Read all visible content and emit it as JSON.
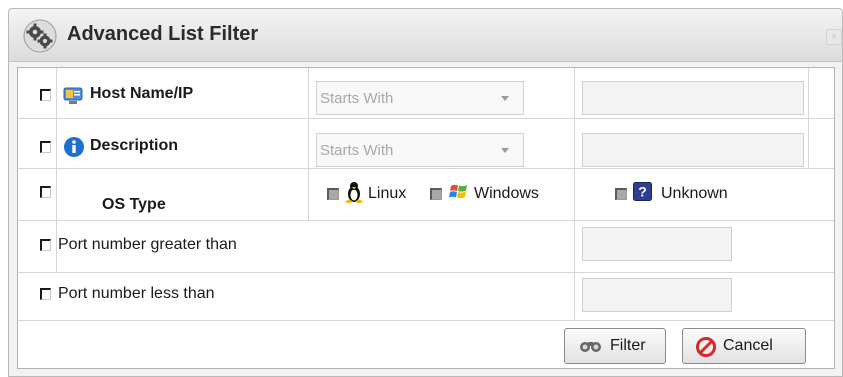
{
  "dialog": {
    "title": "Advanced List Filter",
    "close_label": "×"
  },
  "rows": [
    {
      "label": "Host Name/IP",
      "operator": "Starts With",
      "value": ""
    },
    {
      "label": "Description",
      "operator": "Starts With",
      "value": ""
    },
    {
      "label": "OS Type"
    },
    {
      "label": "Port number greater than",
      "value": ""
    },
    {
      "label": "Port number less than",
      "value": ""
    }
  ],
  "os_types": [
    {
      "label": "Linux"
    },
    {
      "label": "Windows"
    },
    {
      "label": "Unknown"
    }
  ],
  "buttons": {
    "filter": "Filter",
    "cancel": "Cancel"
  },
  "colors": {
    "info_icon": "#1f6fd1",
    "cancel_icon": "#d42a2a",
    "unknown_icon": "#2f3e95"
  }
}
